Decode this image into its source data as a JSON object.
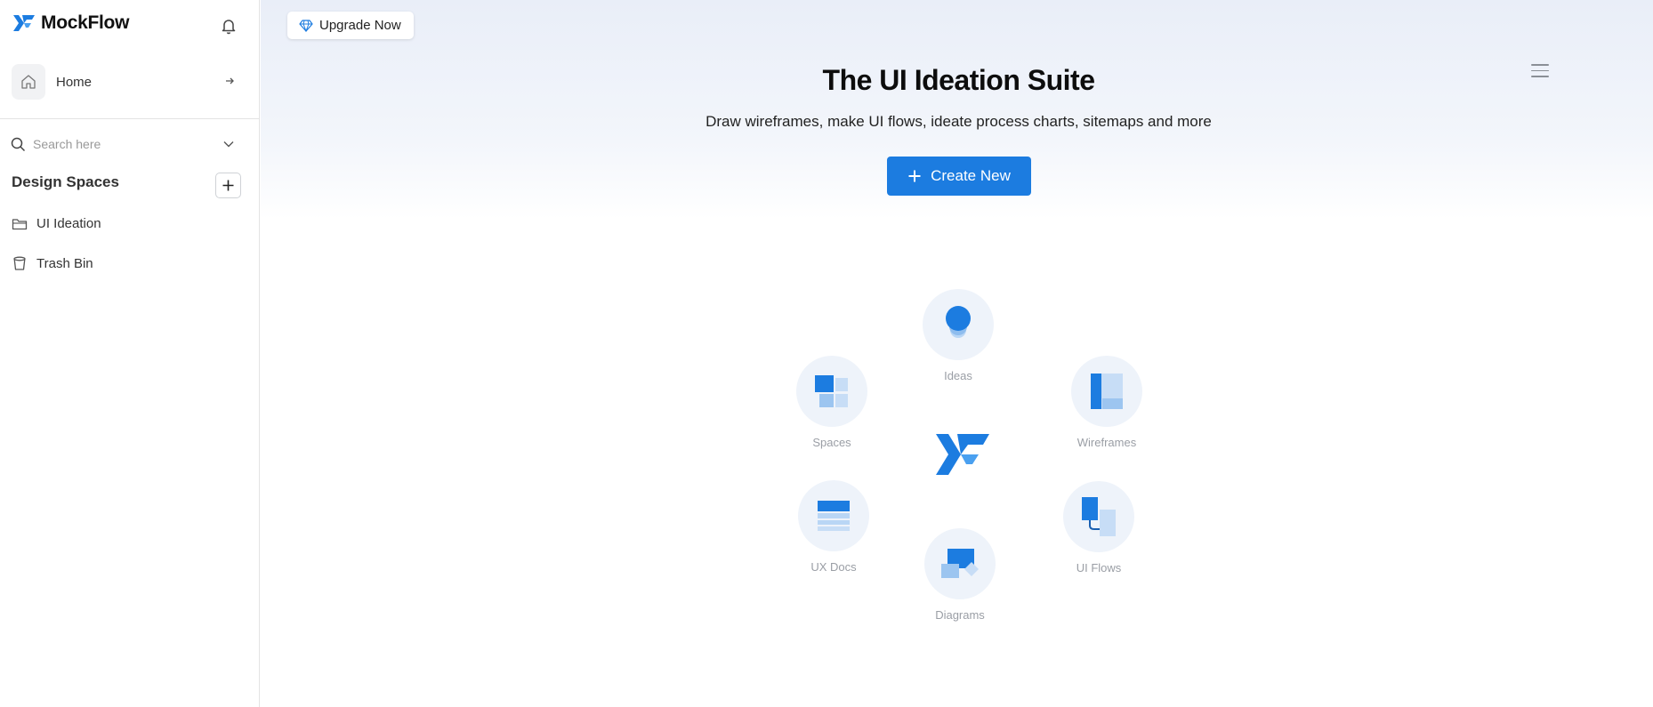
{
  "app": {
    "name": "MockFlow"
  },
  "sidebar": {
    "home_label": "Home",
    "search_placeholder": "Search here",
    "section_title": "Design Spaces",
    "items": [
      {
        "label": "UI Ideation",
        "icon": "folder-icon"
      },
      {
        "label": "Trash Bin",
        "icon": "trash-icon"
      }
    ]
  },
  "header": {
    "upgrade_label": "Upgrade Now"
  },
  "hero": {
    "title": "The UI Ideation Suite",
    "subtitle": "Draw wireframes, make UI flows, ideate process charts, sitemaps and more",
    "create_label": "Create New"
  },
  "features": [
    {
      "label": "Ideas",
      "icon": "bulb-icon"
    },
    {
      "label": "Spaces",
      "icon": "spaces-icon"
    },
    {
      "label": "Wireframes",
      "icon": "wireframes-icon"
    },
    {
      "label": "UX Docs",
      "icon": "ux-docs-icon"
    },
    {
      "label": "UI Flows",
      "icon": "ui-flows-icon"
    },
    {
      "label": "Diagrams",
      "icon": "diagrams-icon"
    }
  ],
  "colors": {
    "accent": "#1c7ce0",
    "accent_light": "#b9d6f5",
    "circle_bg": "#eef3fa"
  }
}
